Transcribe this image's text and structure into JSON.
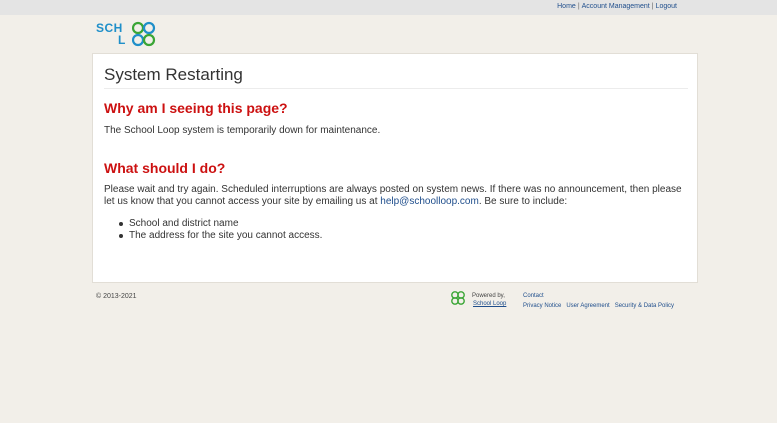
{
  "header": {
    "nav": [
      {
        "label": "Home"
      },
      {
        "label": "Account Management"
      },
      {
        "label": "Logout"
      }
    ],
    "separator": "|"
  },
  "logo": {
    "line1": "SCH",
    "line2": "L",
    "brand_color": "#1f8fc9",
    "icon": "school-loop-logo-icon"
  },
  "main": {
    "title": "System Restarting",
    "section1": {
      "heading": "Why am I seeing this page?",
      "text": "The School Loop system is temporarily down for maintenance."
    },
    "section2": {
      "heading": "What should I do?",
      "text_before": "Please wait and try again. Scheduled interruptions are always posted on system news. If there was no announcement, then please let us know that you cannot access your site by emailing us at ",
      "email": "help@schoolloop.com",
      "text_after": ". Be sure to include:",
      "items": [
        "School and district name",
        "The address for the site you cannot access."
      ]
    },
    "heading_color": "#cc1111",
    "link_color": "#1f4e8c"
  },
  "footer": {
    "copyright": "© 2013-2021",
    "powered_by": "Powered by,",
    "powered_name": "School Loop",
    "contact": "Contact",
    "links": [
      {
        "label": "Privacy Notice"
      },
      {
        "label": "User Agreement"
      },
      {
        "label": "Security & Data Policy"
      }
    ]
  }
}
